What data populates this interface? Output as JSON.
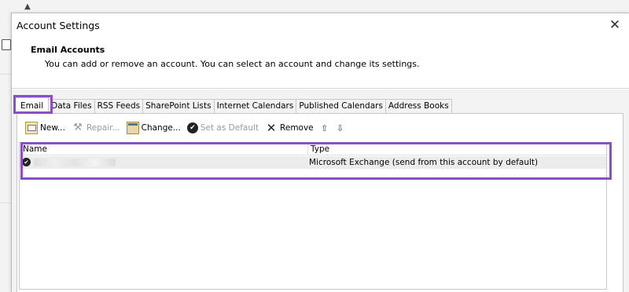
{
  "window": {
    "title": "Account Settings",
    "close_glyph": "✕"
  },
  "header": {
    "title": "Email Accounts",
    "description": "You can add or remove an account. You can select an account and change its settings."
  },
  "tabs": [
    {
      "label": "Email",
      "active": true
    },
    {
      "label": "Data Files"
    },
    {
      "label": "RSS Feeds"
    },
    {
      "label": "SharePoint Lists"
    },
    {
      "label": "Internet Calendars"
    },
    {
      "label": "Published Calendars"
    },
    {
      "label": "Address Books"
    }
  ],
  "toolbar": {
    "new_label": "New...",
    "repair_label": "Repair...",
    "change_label": "Change...",
    "set_default_label": "Set as Default",
    "remove_label": "Remove",
    "move_up_glyph": "⇧",
    "move_down_glyph": "⇩"
  },
  "list": {
    "columns": [
      "Name",
      "Type"
    ],
    "rows": [
      {
        "name": "",
        "type": "Microsoft Exchange (send from this account by default)",
        "is_default": true
      }
    ]
  },
  "highlight_color": "#8a4fc7",
  "icons": {
    "new": "new-account-icon",
    "repair": "repair-icon",
    "change": "change-icon",
    "set_default": "checkmark-circle-icon",
    "remove": "remove-x-icon",
    "up": "arrow-up-icon",
    "down": "arrow-down-icon"
  }
}
